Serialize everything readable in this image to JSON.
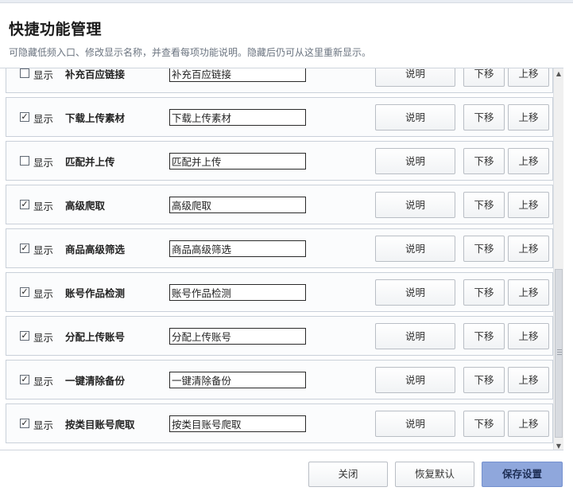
{
  "header": {
    "title": "快捷功能管理",
    "subtitle": "可隐藏低频入口、修改显示名称，并查看每项功能说明。隐藏后仍可从这里重新显示。"
  },
  "labels": {
    "show": "显示",
    "description_button": "说明",
    "move_down_button": "下移",
    "move_up_button": "上移"
  },
  "rows": [
    {
      "name": "补充百应链接",
      "display_name": "补充百应链接",
      "shown": false
    },
    {
      "name": "下载上传素材",
      "display_name": "下载上传素材",
      "shown": true
    },
    {
      "name": "匹配并上传",
      "display_name": "匹配并上传",
      "shown": false
    },
    {
      "name": "高级爬取",
      "display_name": "高级爬取",
      "shown": true
    },
    {
      "name": "商品高级筛选",
      "display_name": "商品高级筛选",
      "shown": true
    },
    {
      "name": "账号作品检测",
      "display_name": "账号作品检测",
      "shown": true
    },
    {
      "name": "分配上传账号",
      "display_name": "分配上传账号",
      "shown": true
    },
    {
      "name": "一键清除备份",
      "display_name": "一键清除备份",
      "shown": true
    },
    {
      "name": "按类目账号爬取",
      "display_name": "按类目账号爬取",
      "shown": true
    }
  ],
  "footer": {
    "close_label": "关闭",
    "reset_label": "恢复默认",
    "save_label": "保存设置"
  },
  "colors": {
    "primary_button": "#8fa7dc"
  },
  "icons": {
    "checkbox_checked": "✓",
    "scroll_up": "▲",
    "scroll_down": "▼"
  }
}
